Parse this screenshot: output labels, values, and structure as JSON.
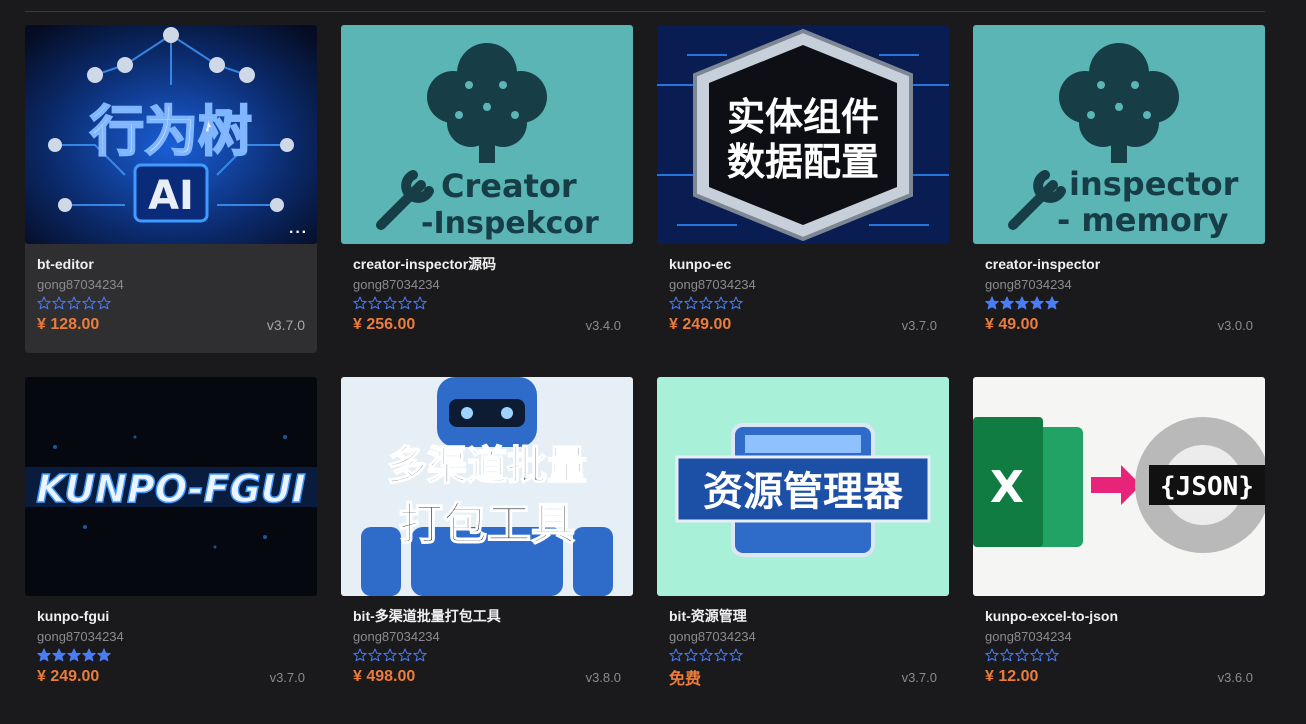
{
  "products": [
    {
      "title": "bt-editor",
      "author": "gong87034234",
      "rating": 0,
      "price": "¥ 128.00",
      "version": "v3.7.0",
      "thumb_text": [
        "行为树",
        "AI"
      ],
      "hovered": true
    },
    {
      "title": "creator-inspector源码",
      "author": "gong87034234",
      "rating": 0,
      "price": "¥ 256.00",
      "version": "v3.4.0",
      "thumb_text": [
        "Creator",
        "-Inspekcor"
      ]
    },
    {
      "title": "kunpo-ec",
      "author": "gong87034234",
      "rating": 0,
      "price": "¥ 249.00",
      "version": "v3.7.0",
      "thumb_text": [
        "实体组件",
        "数据配置"
      ]
    },
    {
      "title": "creator-inspector",
      "author": "gong87034234",
      "rating": 5,
      "price": "¥ 49.00",
      "version": "v3.0.0",
      "thumb_text": [
        "inspector",
        "- memory"
      ]
    },
    {
      "title": "kunpo-fgui",
      "author": "gong87034234",
      "rating": 5,
      "price": "¥ 249.00",
      "version": "v3.7.0",
      "thumb_text": [
        "KUNPO-FGUI"
      ]
    },
    {
      "title": "bit-多渠道批量打包工具",
      "author": "gong87034234",
      "rating": 0,
      "price": "¥ 498.00",
      "version": "v3.8.0",
      "thumb_text": [
        "多渠道批量",
        "打包工具"
      ]
    },
    {
      "title": "bit-资源管理",
      "author": "gong87034234",
      "rating": 0,
      "price": "免费",
      "version": "v3.7.0",
      "thumb_text": [
        "资源管理器"
      ]
    },
    {
      "title": "kunpo-excel-to-json",
      "author": "gong87034234",
      "rating": 0,
      "price": "¥ 12.00",
      "version": "v3.6.0",
      "thumb_text": [
        "X",
        "{JSON}"
      ]
    }
  ],
  "colors": {
    "price": "#ec7c3c",
    "star": "#4a7cf5",
    "teal": "#5bb5b5"
  },
  "icons": {
    "more": "more-horizontal-icon",
    "star": "star-icon"
  }
}
